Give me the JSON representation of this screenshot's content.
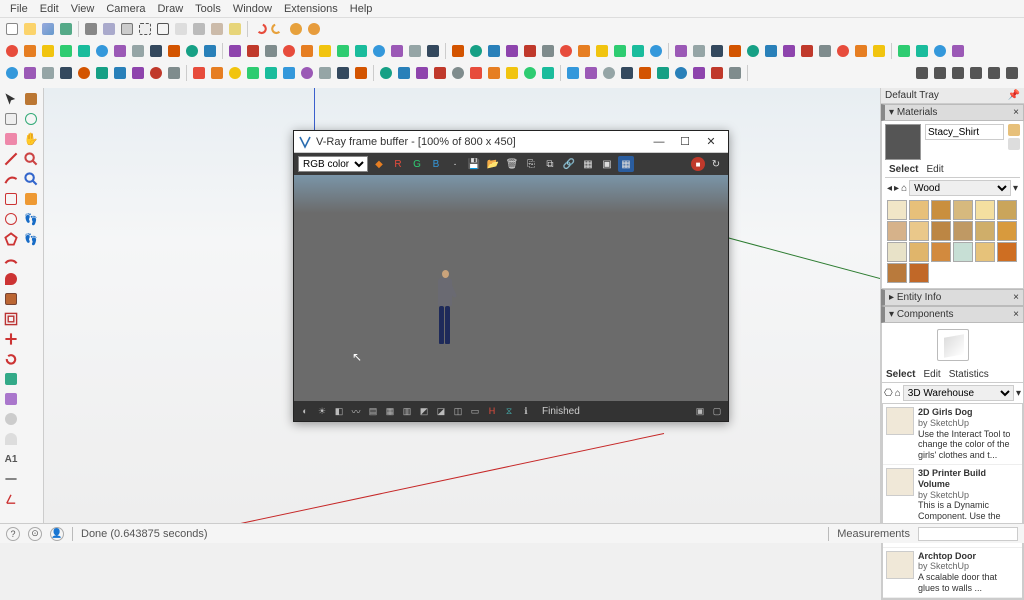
{
  "menu": [
    "File",
    "Edit",
    "View",
    "Camera",
    "Draw",
    "Tools",
    "Window",
    "Extensions",
    "Help"
  ],
  "vfb": {
    "title": "V-Ray frame buffer - [100% of 800 x 450]",
    "channel": "RGB color",
    "channels": {
      "r": "R",
      "g": "G",
      "b": "B",
      "a": "·"
    },
    "status": "Finished"
  },
  "tray": {
    "title": "Default Tray"
  },
  "materials": {
    "header": "Materials",
    "name": "Stacy_Shirt",
    "tabs": {
      "select": "Select",
      "edit": "Edit"
    },
    "collection": "Wood",
    "swatches": [
      "#f1e6c7",
      "#e7c07a",
      "#c98f3e",
      "#d6b97e",
      "#f4dfa0",
      "#caa55b",
      "#d6b28a",
      "#eac88a",
      "#bc8644",
      "#bf9964",
      "#cfae6a",
      "#d89a3d",
      "#e8e2c8",
      "#e0b56b",
      "#d28a3e",
      "#c7dfd5",
      "#e6c27a",
      "#ce6e22",
      "#b97a3c",
      "#c16828"
    ]
  },
  "entity_info": {
    "header": "Entity Info"
  },
  "components": {
    "header": "Components",
    "tabs": {
      "select": "Select",
      "edit": "Edit",
      "stats": "Statistics"
    },
    "source": "3D Warehouse",
    "items": [
      {
        "title": "2D Girls Dog",
        "author": "by SketchUp",
        "desc": "Use the Interact Tool to change the color of the girls' clothes and t..."
      },
      {
        "title": "3D Printer Build Volume",
        "author": "by SketchUp",
        "desc": "This is a Dynamic Component. Use the Component Options window t..."
      },
      {
        "title": "Archtop Door",
        "author": "by SketchUp",
        "desc": "A scalable door that glues to walls ..."
      }
    ]
  },
  "statusbar": {
    "msg": "Done (0.643875 seconds)",
    "measurements_label": "Measurements"
  }
}
